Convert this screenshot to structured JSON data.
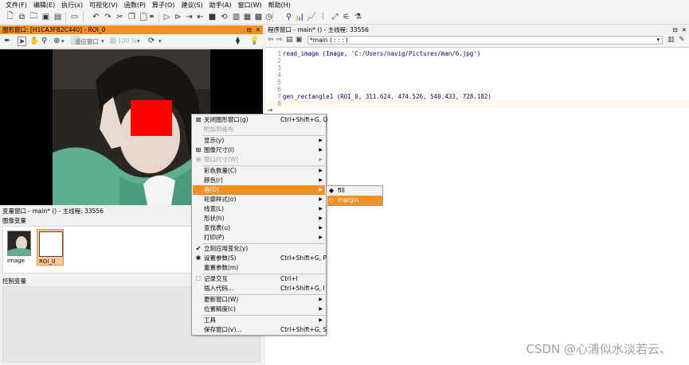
{
  "menubar": [
    "文件(F)",
    "编辑(E)",
    "执行(x)",
    "可视化(V)",
    "函数(P)",
    "算子(O)",
    "建议(S)",
    "助手(A)",
    "窗口(W)",
    "帮助(H)"
  ],
  "graphics_window": {
    "title": "图形窗口: [H1CA3FB2C440] - ROI_0",
    "fit_label": "适应窗口",
    "zoom_label": "100 %"
  },
  "variable_window": {
    "title": "变量窗口 - main* () - 主线程: 33556",
    "iconic_label": "图像变量",
    "control_label": "控制变量",
    "thumbs": [
      {
        "label": "Image"
      },
      {
        "label": "ROI_0"
      }
    ]
  },
  "program_window": {
    "title": "程序窗口 - main* () - 主线程: 33556",
    "procedure": "*main ( : : : )",
    "lines": [
      {
        "num": "1",
        "code": "read_image (Image, 'C:/Users/navig/Pictures/man/6.jpg')"
      },
      {
        "num": "2",
        "code": ""
      },
      {
        "num": "3",
        "code": ""
      },
      {
        "num": "4",
        "code": ""
      },
      {
        "num": "5",
        "code": ""
      },
      {
        "num": "6",
        "code": ""
      },
      {
        "num": "7",
        "code": "gen_rectangle1 (ROI_0, 311.624, 474.526, 540.433, 728.182)"
      },
      {
        "num": "8",
        "code": ""
      }
    ]
  },
  "context_menu": {
    "items": [
      {
        "label": "关闭图形窗口(g)",
        "shortcut": "Ctrl+Shift+G, Q",
        "icon": "close-window-icon"
      },
      {
        "label": "附加到画布",
        "disabled": true
      },
      {
        "label": "显示(y)",
        "submenu": true
      },
      {
        "label": "图像尺寸(I)",
        "submenu": true,
        "icon": "image-size-icon"
      },
      {
        "label": "窗口尺寸(W)",
        "submenu": true,
        "disabled": true,
        "icon": "window-size-icon"
      },
      {
        "label": "彩色数量(C)",
        "submenu": true
      },
      {
        "label": "颜色(r)",
        "submenu": true
      },
      {
        "label": "画(D)",
        "submenu": true,
        "highlighted": true
      },
      {
        "label": "轮廓样式(o)",
        "submenu": true
      },
      {
        "label": "线宽(L)",
        "submenu": true
      },
      {
        "label": "形状(h)",
        "submenu": true
      },
      {
        "label": "查找表(u)",
        "submenu": true
      },
      {
        "label": "打印(P)",
        "submenu": true
      },
      {
        "label": "立刻应用变化(y)",
        "icon": "checkmark-icon"
      },
      {
        "label": "设置参数(S)",
        "shortcut": "Ctrl+Shift+G, P",
        "icon": "gear-icon"
      },
      {
        "label": "重置参数(m)"
      },
      {
        "label": "记录交互",
        "shortcut": "Ctrl+I",
        "disabled": true,
        "icon": "record-checkbox-icon"
      },
      {
        "label": "插入代码...",
        "shortcut": "Ctrl+Shift+G, I"
      },
      {
        "label": "更新窗口(W)",
        "submenu": true
      },
      {
        "label": "位置精度(c)",
        "submenu": true
      },
      {
        "label": "工具",
        "submenu": true
      },
      {
        "label": "保存窗口(v)...",
        "shortcut": "Ctrl+Shift+G, S"
      }
    ],
    "submenu": [
      {
        "label": "fill",
        "icon": "fill-icon"
      },
      {
        "label": "margin",
        "icon": "margin-icon",
        "highlighted": true
      }
    ]
  },
  "watermark": "CSDN @心清似水淡若云、",
  "colors": {
    "accent": "#f39021",
    "roi": "#ff0000",
    "code": "#00008b"
  }
}
